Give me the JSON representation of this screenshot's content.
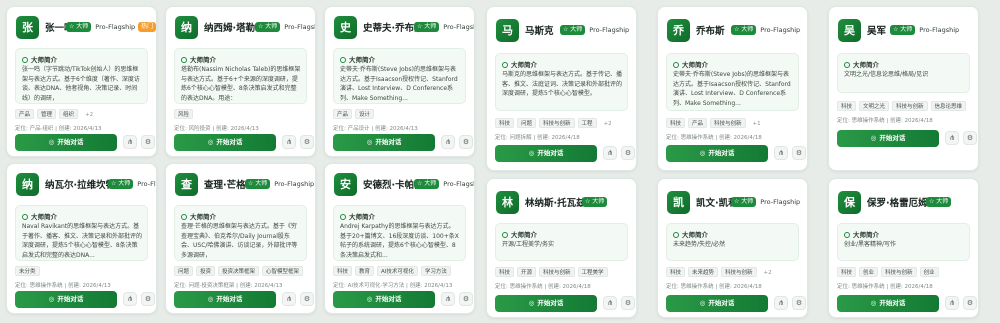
{
  "ui": {
    "master_badge": "☆ 大师",
    "pro_badge": "Pro-Flagship",
    "hot_badge": "热门",
    "intro_title": "大师简介",
    "start_label": "开始对话",
    "more": "+2",
    "more1": "+1"
  },
  "cards": [
    {
      "avatar": "张",
      "name": "张一鸣",
      "intro": "张一鸣（字节跳动/TikTok创始人）的思维框架与表达方式。基于6个维度（著作、深度访谈、表达DNA、他者视角、决策记录、时间线）的调研，",
      "tags": [
        "产品",
        "管理",
        "组织"
      ],
      "meta": "定位: 产品·组织 | 创建: 2026/4/13"
    },
    {
      "avatar": "纳",
      "name": "纳西姆·塔勒布",
      "intro": "塔勒布(Nassim Nicholas Taleb)的思维框架与表达方式。基于6+个来源的深度调研，提炼6个核心心智模型、8条决策启发式和完整的表达DNA。用途：",
      "tags": [
        "风险"
      ],
      "meta": "定位: 风险投资 | 创建: 2026/4/13"
    },
    {
      "avatar": "史",
      "name": "史蒂夫·乔布斯",
      "intro": "史蒂夫·乔布斯(Steve Jobs)的思维框架与表达方式。基于Isaacson授权传记、Stanford演讲、Lost Interview、D Conference系列、Make Something...",
      "tags": [
        "产品",
        "设计"
      ],
      "meta": "定位: 产品设计 | 创建: 2026/4/13"
    },
    {
      "avatar": "纳",
      "name": "纳瓦尔·拉维坎特",
      "intro": "Naval Ravikant的思维框架与表达方式。基于著作、播客、推文、决策记录和外部批评的深度调研，提炼5个核心心智模型、8条决策启发式和完整的表达DNA...",
      "tags": [
        "未分类"
      ],
      "meta": "定位: 思维操作系统 | 创建: 2026/4/13"
    },
    {
      "avatar": "查",
      "name": "查理·芒格",
      "intro": "查理·芒格的思维框架与表达方式。基于《穷查理宝典》、伯克希尔/Daily Journal股东会、USC/哈佛演讲、访谈记录，外部批评等多源调研，",
      "tags": [
        "问题",
        "投资",
        "投资决策框架",
        "心智模型框架"
      ],
      "meta": "定位: 问题·投资决策框架 | 创建: 2026/4/13"
    },
    {
      "avatar": "安",
      "name": "安德烈·卡帕西",
      "intro": "Andrej Karpathy的思维框架与表达方式。基于20+篇博文、16段深度访谈、100+条X帖子的系统调研，提炼6个核心心智模型、8条决策启发式和...",
      "tags": [
        "科技",
        "教育",
        "AI技术可视化",
        "学习方法"
      ],
      "meta": "定位: AI技术可视化·学习方法 | 创建: 2026/4/13"
    },
    {
      "avatar": "马",
      "name": "马斯克",
      "intro": "马斯克的思维框架与表达方式。基于传记、播客、推文、法庭证词、决策记录和外部批评的深度调研，提炼5个核心心智模型。",
      "tags": [
        "科技",
        "问题",
        "科技与创新",
        "工程"
      ],
      "meta": "定位: 问题拆解 | 创建: 2026/4/18"
    },
    {
      "avatar": "乔",
      "name": "乔布斯",
      "intro": "史蒂夫·乔布斯(Steve Jobs)的思维框架与表达方式。基于Isaacson授权传记、Stanford演讲、Lost Interview、D Conference系列、Make Something...",
      "tags": [
        "科技",
        "产品",
        "科技与创新",
        "设计"
      ],
      "meta": "定位: 思维操作系统 | 创建: 2026/4/18"
    },
    {
      "avatar": "吴",
      "name": "吴军",
      "intro": "文明之光/信息论思维/格局/见识",
      "tags": [
        "科技",
        "文明之光",
        "科技与创新",
        "信息论思维"
      ],
      "meta": "定位: 思维操作系统 | 创建: 2026/4/18"
    },
    {
      "avatar": "林",
      "name": "林纳斯·托瓦兹",
      "intro": "开源/工程美学/务实",
      "tags": [
        "科技",
        "开源",
        "科技与创新",
        "工程美学"
      ],
      "meta": "定位: 思维操作系统 | 创建: 2026/4/18"
    },
    {
      "avatar": "凯",
      "name": "凯文·凯利",
      "intro": "未来趋势/失控/必然",
      "tags": [
        "科技",
        "未来趋势",
        "科技与创新"
      ],
      "meta": "定位: 思维操作系统 | 创建: 2026/4/18"
    },
    {
      "avatar": "保",
      "name": "保罗·格雷厄姆",
      "intro": "创业/黑客精神/写作",
      "tags": [
        "科技",
        "创业",
        "科技与创新",
        "创业"
      ],
      "meta": "定位: 思维操作系统 | 创建: 2026/4/18"
    }
  ]
}
